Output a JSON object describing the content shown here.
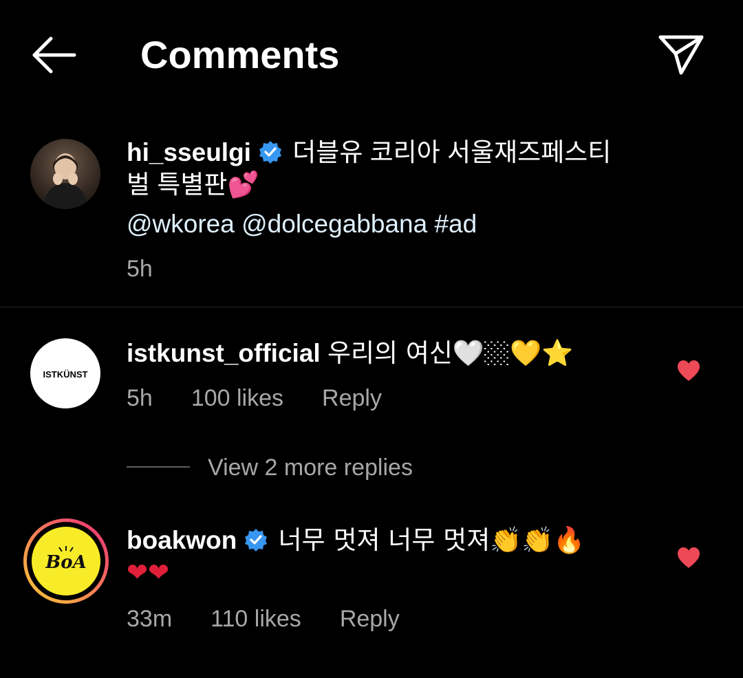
{
  "header": {
    "title": "Comments",
    "back_icon": "arrow-left-icon",
    "send_icon": "paper-plane-icon"
  },
  "colors": {
    "background": "#000000",
    "text": "#ffffff",
    "secondary_text": "#a8a8a8",
    "mention": "#e0f1ff",
    "verified_badge": "#3897f0",
    "like_heart": "#ed4956",
    "divider": "#262626",
    "story_ring_start": "#f9ce34",
    "story_ring_end": "#ee2a7b"
  },
  "caption": {
    "username": "hi_sseulgi",
    "verified": true,
    "text_line1": "더블유 코리아 서울재즈페스티",
    "text_line2": "벌 특별판💕",
    "mentions": "@wkorea @dolcegabbana #ad",
    "time": "5h"
  },
  "comments": [
    {
      "username": "istkunst_official",
      "avatar_text": "ISTKÜNST",
      "text": "우리의 여신🤍🏼💛⭐",
      "time": "5h",
      "likes": "100 likes",
      "reply_label": "Reply",
      "liked": true
    },
    {
      "username": "boakwon",
      "verified": true,
      "avatar_text": "BoA",
      "text_line1": "너무 멋져 너무 멋져👏👏🔥",
      "text_line2": "❤❤",
      "time": "33m",
      "likes": "110 likes",
      "reply_label": "Reply",
      "liked": true
    }
  ],
  "view_replies": {
    "label": "View 2 more replies"
  }
}
